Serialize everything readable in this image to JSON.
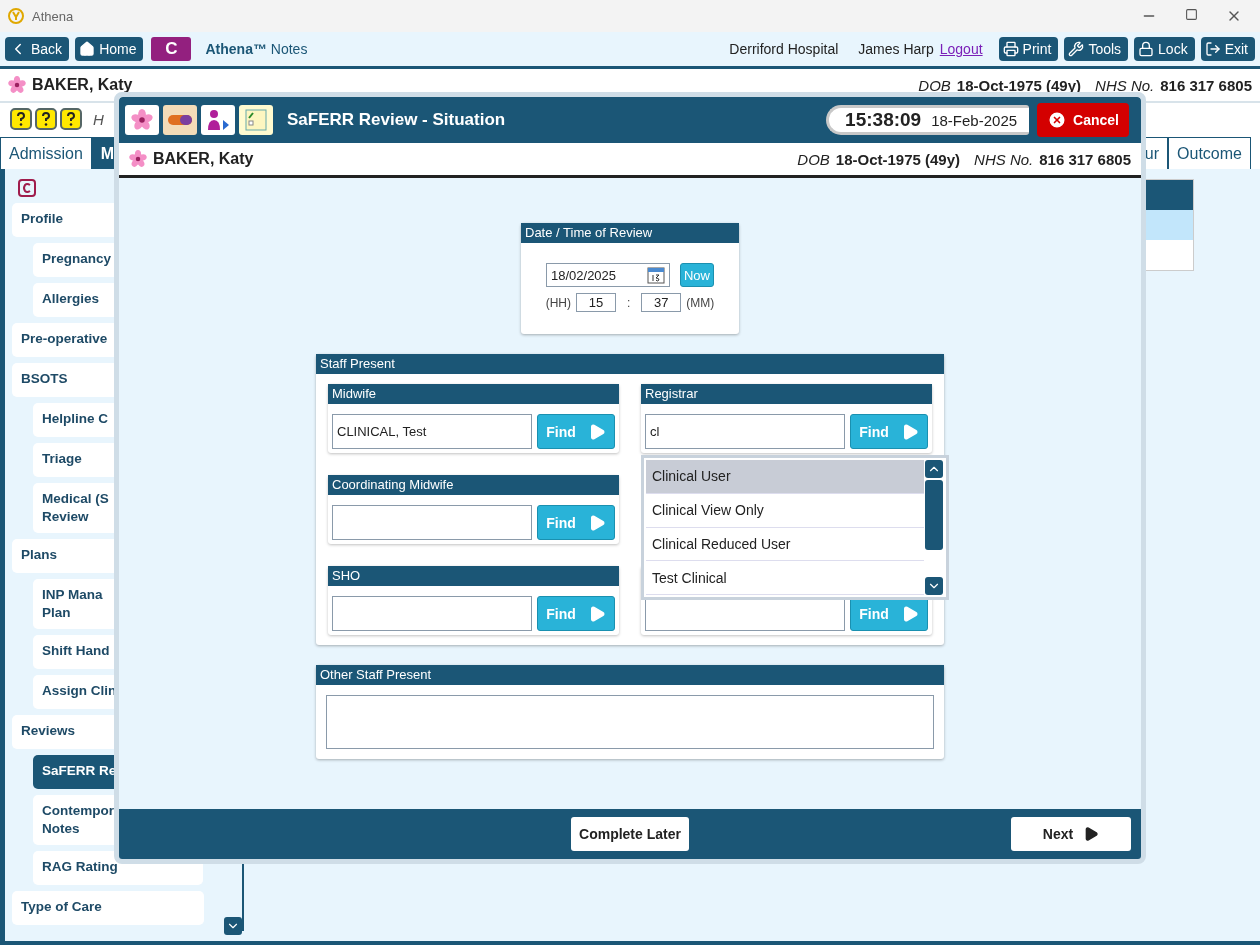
{
  "window": {
    "title": "Athena"
  },
  "toolbar": {
    "nav": [
      {
        "label": "Back"
      },
      {
        "label": "Home"
      }
    ],
    "badge": "C",
    "app_name": "**Athena™** Notes",
    "site": "Derriford Hospital",
    "user": "James Harp",
    "logout": "Logout",
    "actions": [
      {
        "label": "Print"
      },
      {
        "label": "Tools"
      },
      {
        "label": "Lock"
      },
      {
        "label": "Exit"
      }
    ]
  },
  "patient": {
    "name": "BAKER, Katy",
    "dob_label": "DOB",
    "dob": "18-Oct-1975 (49y)",
    "nhs_label": "NHS No.",
    "nhs": "816 317 6805"
  },
  "info_row": {
    "text": "H"
  },
  "tabs_left": [
    {
      "label": "Admission",
      "selected": false
    },
    {
      "label": "M",
      "selected": true
    }
  ],
  "tabs_right": [
    {
      "label": "ur",
      "selected": false
    },
    {
      "label": "Outcome",
      "selected": false
    }
  ],
  "sidebar": {
    "items": [
      {
        "label": "Profile",
        "selected": false,
        "children": [
          {
            "label": "Pregnancy",
            "selected": false
          },
          {
            "label": "Allergies",
            "selected": false
          }
        ]
      },
      {
        "label": "Pre-operative",
        "selected": false
      },
      {
        "label": "BSOTS",
        "selected": false,
        "children": [
          {
            "label": "Helpline C",
            "selected": false
          },
          {
            "label": "Triage",
            "selected": false
          },
          {
            "label": "Medical (S\nReview",
            "selected": false
          }
        ]
      },
      {
        "label": "Plans",
        "selected": false,
        "children": [
          {
            "label": "INP Mana\nPlan",
            "selected": false
          },
          {
            "label": "Shift Hand",
            "selected": false
          },
          {
            "label": "Assign Clin",
            "selected": false
          }
        ]
      },
      {
        "label": "Reviews",
        "selected": false,
        "children": [
          {
            "label": "SaFERR Re",
            "selected": true
          },
          {
            "label": "Contempor\nNotes",
            "selected": false
          },
          {
            "label": "RAG Rating",
            "selected": false
          }
        ]
      },
      {
        "label": "Type of Care",
        "selected": false
      }
    ]
  },
  "modal": {
    "title": "SaFERR Review - Situation",
    "time": "15:38:09",
    "date": "18-Feb-2025",
    "cancel": "Cancel",
    "patient": {
      "name": "BAKER, Katy",
      "dob_label": "DOB",
      "dob": "18-Oct-1975 (49y)",
      "nhs_label": "NHS No.",
      "nhs": "816 317 6805"
    },
    "review_time": {
      "title": "Date / Time of Review",
      "date": "18/02/2025",
      "now": "Now",
      "hh_label": "(HH)",
      "hh": "15",
      "separator": ":",
      "mm": "37",
      "mm_label": "(MM)"
    },
    "staff": {
      "title": "Staff Present",
      "left_roles": [
        {
          "title": "Midwife",
          "value": "CLINICAL, Test",
          "find": "Find"
        },
        {
          "title": "Coordinating Midwife",
          "find": "Find"
        },
        {
          "title": "SHO",
          "find": "Find"
        }
      ],
      "right_roles": [
        {
          "title": "Registrar",
          "value": "cl",
          "find": "Find"
        },
        {
          "find": "Find"
        }
      ],
      "suggestions": [
        {
          "label": "Clinical User",
          "selected": true
        },
        {
          "label": "Clinical View Only",
          "selected": false
        },
        {
          "label": "Clinical Reduced User",
          "selected": false
        },
        {
          "label": "Test Clinical",
          "selected": false
        }
      ]
    },
    "other_staff": {
      "title": "Other Staff Present"
    },
    "footer": {
      "complete_later": "Complete Later",
      "next": "Next"
    }
  }
}
